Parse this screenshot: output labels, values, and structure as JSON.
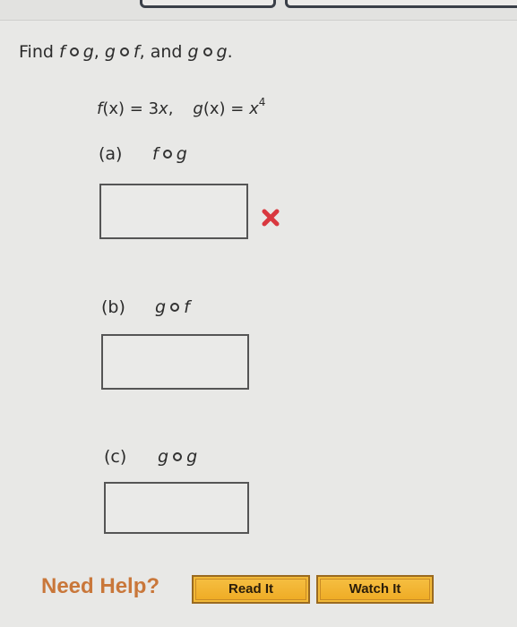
{
  "question": {
    "prefix": "Find",
    "compositions": [
      {
        "outer": "f",
        "inner": "g",
        "after": ","
      },
      {
        "outer": "g",
        "inner": "f",
        "after": ", and"
      },
      {
        "outer": "g",
        "inner": "g",
        "after": "."
      }
    ]
  },
  "given": {
    "f_name": "f",
    "f_def": "(x) = 3",
    "f_var": "x",
    "f_after": ",",
    "g_name": "g",
    "g_def": "(x) = ",
    "g_var": "x",
    "g_exp": "4"
  },
  "parts": [
    {
      "letter": "(a)",
      "outer": "f",
      "inner": "g",
      "answer": "",
      "status": "incorrect"
    },
    {
      "letter": "(b)",
      "outer": "g",
      "inner": "f",
      "answer": "",
      "status": ""
    },
    {
      "letter": "(c)",
      "outer": "g",
      "inner": "g",
      "answer": "",
      "status": ""
    }
  ],
  "status_icons": {
    "incorrect": "x-mark-icon",
    "incorrect_color": "#d9383f"
  },
  "help": {
    "label": "Need Help?",
    "buttons": [
      {
        "label": "Read It"
      },
      {
        "label": "Watch It"
      }
    ],
    "label_color": "#c9773a",
    "button_color": "#f0b030"
  }
}
